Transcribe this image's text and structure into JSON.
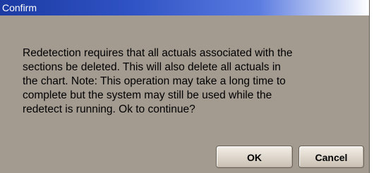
{
  "window": {
    "title": "Confirm"
  },
  "message": {
    "text": "Redetection requires that all actuals associated with the\nsections be deleted.  This will also delete all actuals in\nthe chart.  Note:  This operation may take a long time to\ncomplete but the system may still be used while the\nredetect is running.  Ok to continue?"
  },
  "buttons": {
    "ok_label": "OK",
    "cancel_label": "Cancel"
  },
  "colors": {
    "title_bar_start": "#1c3ba3",
    "title_bar_end": "#ffffff",
    "dialog_background": "#a39a90"
  }
}
